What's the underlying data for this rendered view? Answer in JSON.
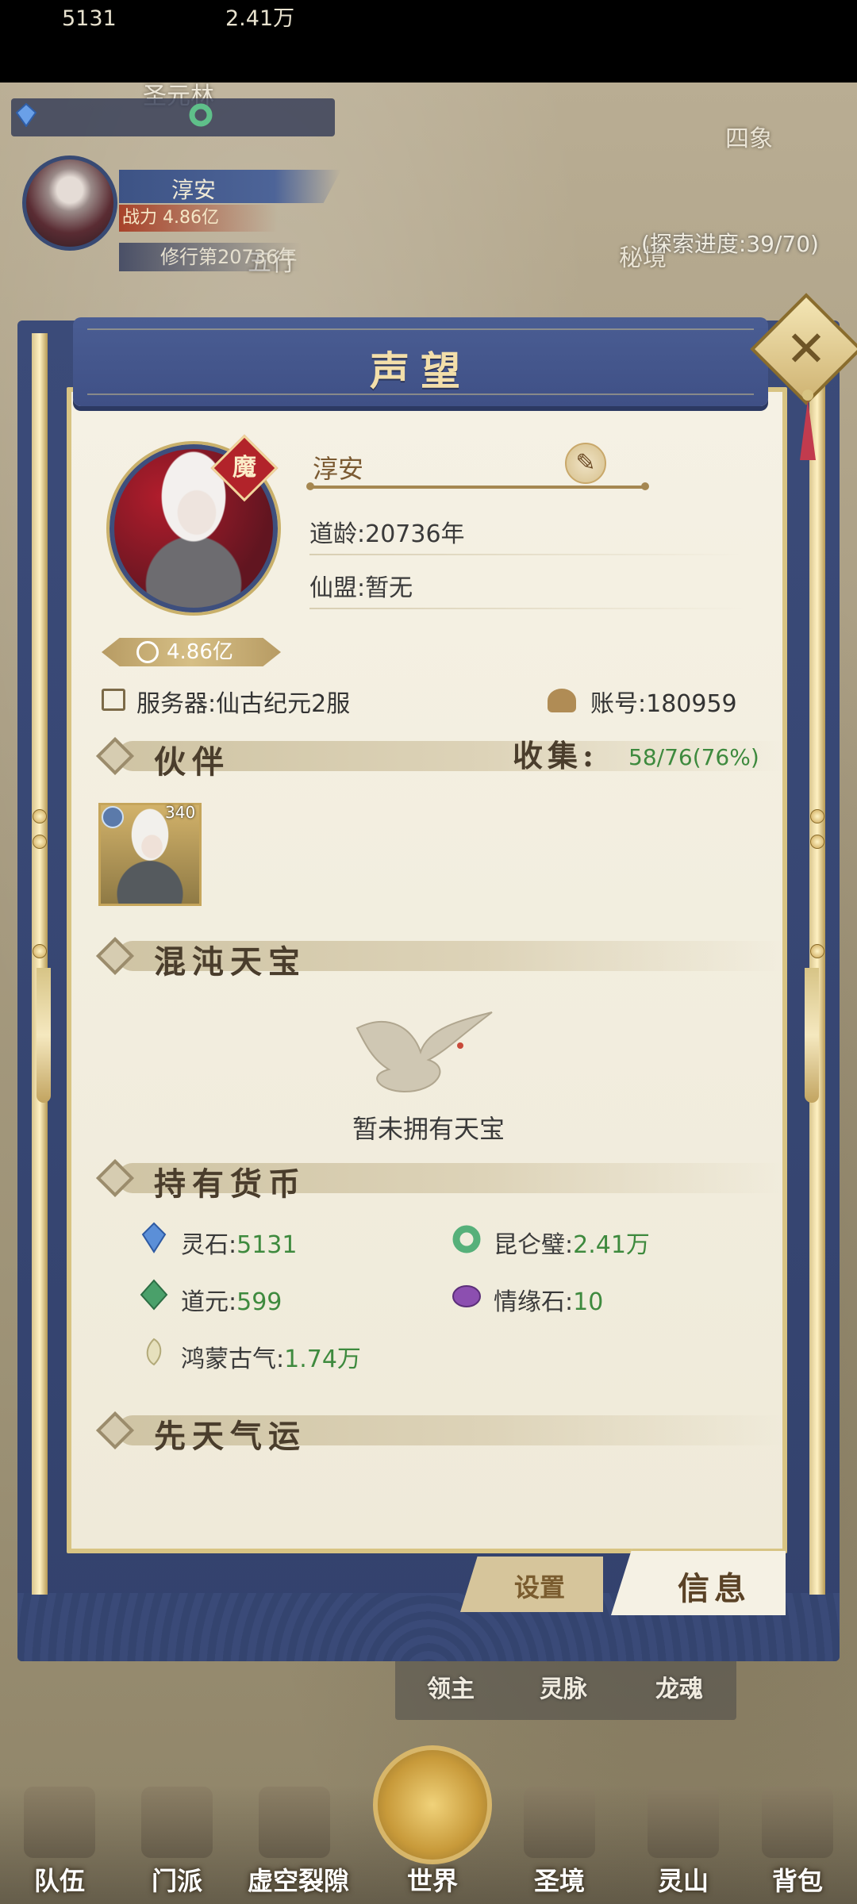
{
  "hud": {
    "map_region": "圣元林",
    "map_region_right": "四象",
    "map_region_secret": "秘境",
    "map_region_wuxing": "五行",
    "spirit_stone": "5131",
    "kunlun_jade": "2.41万",
    "player_name": "淳安",
    "power": "战力 4.86亿",
    "cultivation": "修行第20736年",
    "explore_progress": "(探索进度:39/70)"
  },
  "dialog": {
    "title": "声望",
    "close_icon": "close-icon",
    "profile": {
      "name": "淳安",
      "badge": "魔",
      "dao_age": "道龄:20736年",
      "alliance": "仙盟:暂无",
      "power": "4.86亿",
      "server": "服务器:仙古纪元2服",
      "account": "账号:180959"
    },
    "partner": {
      "section_title": "伙伴",
      "collect_label": "收集:",
      "collect_value": "58/76(76%)",
      "cards": [
        {
          "level": "340"
        }
      ]
    },
    "treasure": {
      "section_title": "混沌天宝",
      "empty_text": "暂未拥有天宝"
    },
    "currency": {
      "section_title": "持有货币",
      "items": [
        {
          "label": "灵石:",
          "value": "5131",
          "icon": "spirit-stone-icon",
          "color": "#5b8fd8"
        },
        {
          "label": "昆仑璧:",
          "value": "2.41万",
          "icon": "jade-ring-icon",
          "color": "#56b07a"
        },
        {
          "label": "道元:",
          "value": "599",
          "icon": "dao-crystal-icon",
          "color": "#4aa06a"
        },
        {
          "label": "情缘石:",
          "value": "10",
          "icon": "love-stone-icon",
          "color": "#8c4fb0"
        },
        {
          "label": "鸿蒙古气:",
          "value": "1.74万",
          "icon": "primal-qi-icon",
          "color": "#d8d2a8"
        }
      ]
    },
    "fortune": {
      "section_title": "先天气运"
    },
    "tabs": {
      "settings": "设置",
      "info": "信息"
    }
  },
  "submenu": {
    "items": [
      "领主",
      "灵脉",
      "龙魂"
    ]
  },
  "nav": {
    "items": [
      "队伍",
      "门派",
      "虚空裂隙",
      "世界",
      "圣境",
      "灵山",
      "背包"
    ]
  },
  "colors": {
    "accent_green": "#3e8a3e",
    "frame_blue": "#3b4b79",
    "gold": "#d8c483"
  }
}
